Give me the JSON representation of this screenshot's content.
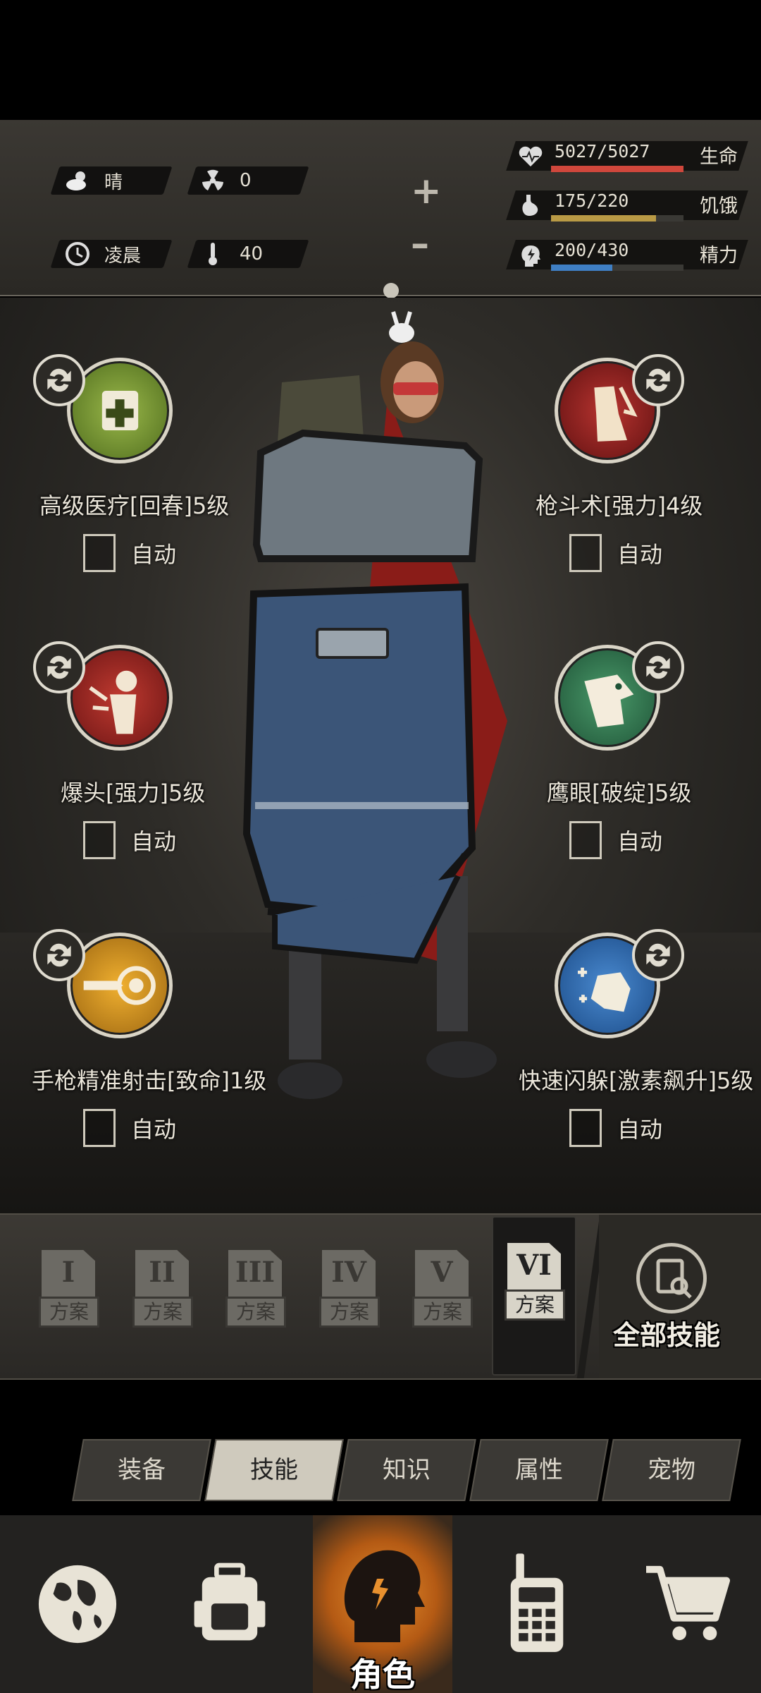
{
  "status": {
    "weather": "晴",
    "radiation": "0",
    "time_of_day": "凌晨",
    "temperature": "40",
    "health": {
      "value": "5027/5027",
      "label": "生命",
      "fraction": 1.0,
      "color": "#d0473c"
    },
    "hunger": {
      "value": "175/220",
      "label": "饥饿",
      "fraction": 0.795,
      "color": "#b99a45"
    },
    "energy": {
      "value": "200/430",
      "label": "精力",
      "fraction": 0.465,
      "color": "#3f7fc4"
    }
  },
  "skills": {
    "left": [
      {
        "name": "高级医疗[回春]5级",
        "auto_label": "自动",
        "icon": "medical-kit-icon",
        "color": "#6c8a2a"
      },
      {
        "name": "爆头[强力]5级",
        "auto_label": "自动",
        "icon": "headshot-icon",
        "color": "#8e1d1d"
      },
      {
        "name": "手枪精准射击[致命]1级",
        "auto_label": "自动",
        "icon": "bullet-target-icon",
        "color": "#c88b1a"
      }
    ],
    "right": [
      {
        "name": "枪斗术[强力]4级",
        "auto_label": "自动",
        "icon": "gun-fu-icon",
        "color": "#8e1d1d"
      },
      {
        "name": "鹰眼[破绽]5级",
        "auto_label": "自动",
        "icon": "eagle-eye-icon",
        "color": "#2e6a48"
      },
      {
        "name": "快速闪躲[激素飙升]5级",
        "auto_label": "自动",
        "icon": "dodge-icon",
        "color": "#2a5ea0"
      }
    ]
  },
  "plans": {
    "numerals": [
      "I",
      "II",
      "III",
      "IV",
      "V",
      "VI"
    ],
    "tag": "方案",
    "active_index": 5,
    "all_skills_label": "全部技能"
  },
  "tabs": {
    "items": [
      "装备",
      "技能",
      "知识",
      "属性",
      "宠物"
    ],
    "active": "技能"
  },
  "nav": {
    "center_label": "角色",
    "items": [
      "globe-icon",
      "backpack-icon",
      "character-icon",
      "walkie-talkie-icon",
      "shopping-cart-icon"
    ]
  }
}
